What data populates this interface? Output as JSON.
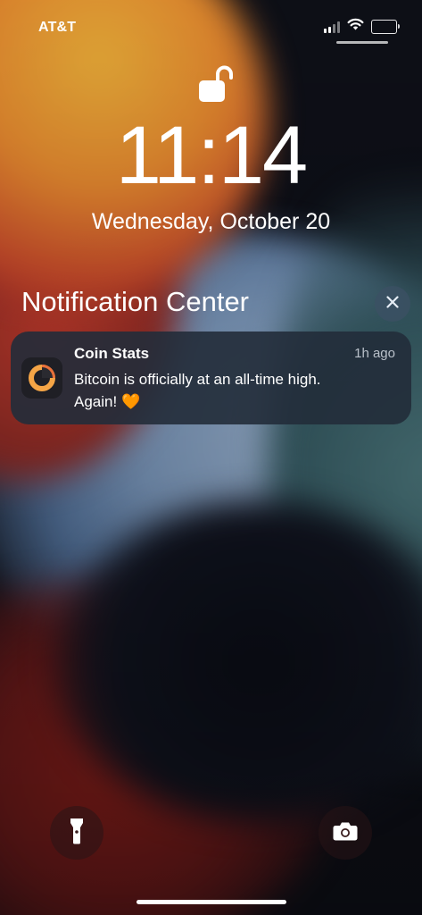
{
  "status_bar": {
    "carrier": "AT&T",
    "icons": [
      "cellular-signal-icon",
      "wifi-icon",
      "battery-icon"
    ]
  },
  "lock_screen": {
    "lock_icon": "unlocked-padlock-icon",
    "time": "11:14",
    "date": "Wednesday, October 20"
  },
  "notification_center": {
    "title": "Notification Center",
    "close_icon": "close-icon",
    "notifications": [
      {
        "app_name": "Coin Stats",
        "time_ago": "1h ago",
        "message": "Bitcoin is officially at an all-time high. Again! ",
        "emoji": "🧡",
        "app_icon": "coin-stats-app-icon"
      }
    ]
  },
  "bottom_controls": {
    "flashlight_icon": "flashlight-icon",
    "camera_icon": "camera-icon"
  },
  "colors": {
    "accent_orange": "#f39a3a",
    "notification_bg": "#222c3a"
  }
}
